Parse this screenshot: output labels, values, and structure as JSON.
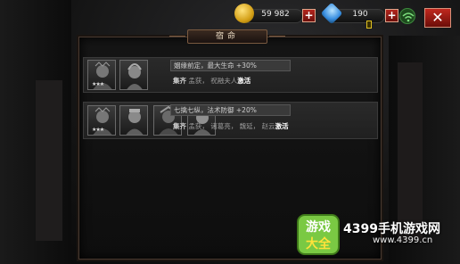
{
  "hud": {
    "gold_value": "59 982",
    "gem_value": "190",
    "plus_label": "+",
    "close_label": "✕"
  },
  "panel": {
    "title": "宿命"
  },
  "bonds": [
    {
      "effect": "姻缘前定，最大生命 +30%",
      "req_label": "集齐",
      "heroes": [
        "孟获",
        "祝融夫人"
      ],
      "status": "激活",
      "portraits": [
        {
          "stars": "★★★"
        },
        {
          "stars": ""
        }
      ]
    },
    {
      "effect": "七擒七纵，法术防御 +20%",
      "req_label": "集齐",
      "heroes": [
        "孟获",
        "诸葛亮",
        "魏延",
        "赵云"
      ],
      "status": "激活",
      "portraits": [
        {
          "stars": "★★★"
        },
        {
          "stars": ""
        },
        {
          "stars": ""
        },
        {
          "stars": ""
        }
      ]
    }
  ],
  "watermark": {
    "logo_text_top": "游戏",
    "logo_text_bottom": "大全",
    "brand": "4399手机游戏网",
    "url": "www.4399.cn"
  },
  "colors": {
    "panel_border": "#4a3a30",
    "plus_button": "#b3261e",
    "gold_icon": "#d4a017",
    "gem_icon": "#3a8fe0",
    "watermark_green": "#7ac943"
  }
}
